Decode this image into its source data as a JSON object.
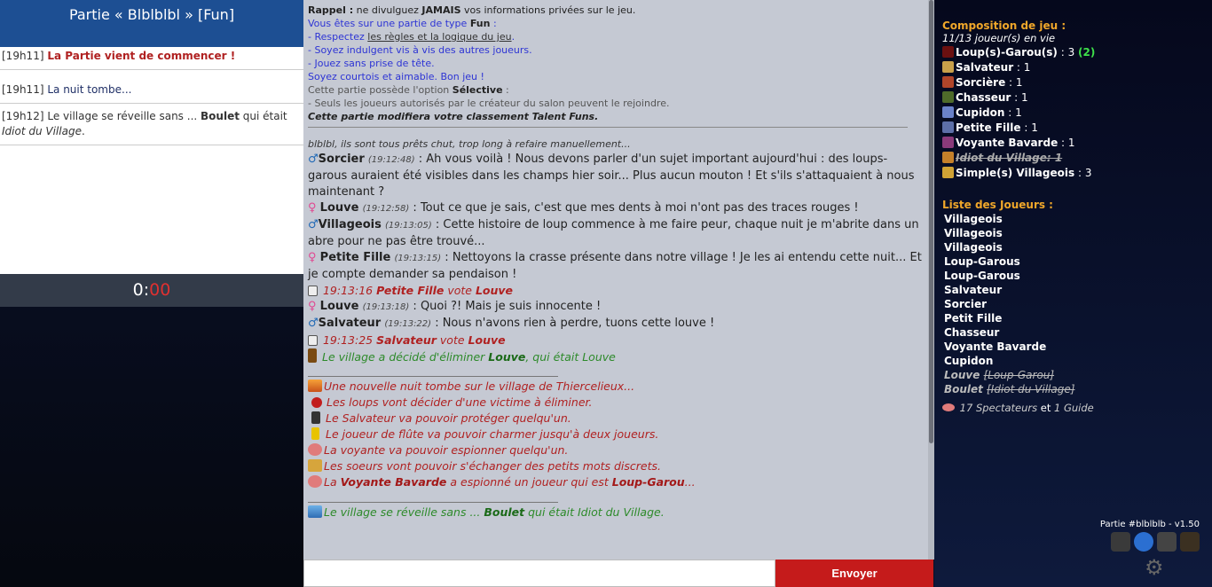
{
  "left": {
    "title": "Partie « Blblblbl » [Fun]",
    "events": [
      {
        "time": "[19h11]",
        "text": "La Partie vient de commencer !"
      },
      {
        "time": "[19h11]",
        "text": "La nuit tombe..."
      },
      {
        "time": "[19h12]",
        "pre": "Le village se réveille sans ...",
        "bold": "Boulet",
        "mid": "qui était",
        "ital": "Idiot du Village",
        "end": "."
      }
    ],
    "timer_min": "0:",
    "timer_sec": "00"
  },
  "rules": {
    "r1_label": "Rappel :",
    "r1_text": " ne divulguez ",
    "r1_bold": "JAMAIS",
    "r1_end": " vos informations privées sur le jeu.",
    "r2": "Vous êtes sur une partie de type ",
    "r2_type": "Fun",
    "r2_end": " :",
    "r3_pre": "- Respectez ",
    "r3_link": "les règles et la logique du jeu",
    "r3_end": ".",
    "r4": "- Soyez indulgent vis à vis des autres joueurs.",
    "r5": "- Jouez sans prise de tête.",
    "r6": "Soyez courtois et aimable. Bon jeu !",
    "r7": "Cette partie possède l'option ",
    "r7_bold": "Sélective",
    "r7_end": " :",
    "r8": "- Seuls les joueurs autorisés par le créateur du salon peuvent le rejoindre.",
    "r9": "Cette partie modifiera votre classement Talent Funs."
  },
  "chat": {
    "narration": "blblbl, ils sont tous prêts chut, trop long à refaire manuellement...",
    "messages": [
      {
        "gender": "♂",
        "who": "Sorcier",
        "time": "(19:12:48)",
        "text": " : Ah vous voilà ! Nous devons parler d'un sujet important aujourd'hui : des loups-garous auraient été visibles dans les champs hier soir... Plus aucun mouton ! Et s'ils s'attaquaient à nous maintenant ?"
      },
      {
        "gender": "♀",
        "who": "Louve",
        "time": "(19:12:58)",
        "text": " : Tout ce que je sais, c'est que mes dents à moi n'ont pas des traces rouges !"
      },
      {
        "gender": "♂",
        "who": "Villageois",
        "time": "(19:13:05)",
        "text": " : Cette histoire de loup commence à me faire peur, chaque nuit je m'abrite dans un abre pour ne pas être trouvé..."
      },
      {
        "gender": "♀",
        "who": "Petite Fille",
        "time": "(19:13:15)",
        "text": " : Nettoyons la crasse présente dans notre village ! Je les ai entendu cette nuit... Et je compte demander sa pendaison !"
      }
    ],
    "vote1": {
      "time": "19:13:16",
      "who": "Petite Fille",
      "verb": " vote ",
      "target": "Louve"
    },
    "messages2": [
      {
        "gender": "♀",
        "who": "Louve",
        "time": "(19:13:18)",
        "text": " : Quoi ?! Mais je suis innocente !"
      },
      {
        "gender": "♂",
        "who": "Salvateur",
        "time": "(19:13:22)",
        "text": " : Nous n'avons rien à perdre, tuons cette louve !"
      }
    ],
    "vote2": {
      "time": "19:13:25",
      "who": "Salvateur",
      "verb": " vote ",
      "target": "Louve"
    },
    "elim": {
      "pre": "Le village a décidé d'éliminer ",
      "who": "Louve",
      "end": ", qui était Louve"
    },
    "night": [
      "Une nouvelle nuit tombe sur le village de Thiercelieux...",
      "Les loups vont décider d'une victime à éliminer.",
      "Le Salvateur va pouvoir protéger quelqu'un.",
      "Le joueur de flûte va pouvoir charmer jusqu'à deux joueurs.",
      "La voyante va pouvoir espionner quelqu'un.",
      "Les soeurs vont pouvoir s'échanger des petits mots discrets."
    ],
    "spy": {
      "pre": "La ",
      "who": "Voyante Bavarde",
      "mid": " a espionné un joueur qui est ",
      "role": "Loup-Garou",
      "end": "..."
    },
    "day": {
      "pre": "Le village se réveille sans ... ",
      "who": "Boulet",
      "end": " qui était Idiot du Village."
    }
  },
  "input": {
    "placeholder": "",
    "send_label": "Envoyer"
  },
  "right": {
    "composition_title": "Composition de jeu :",
    "alive": "11/13 joueur(s) en vie",
    "roles": [
      {
        "name": "Loup(s)-Garou(s)",
        "count": " : 3 ",
        "extra": "(2)",
        "color": "#6b1010"
      },
      {
        "name": "Salvateur",
        "count": " : 1",
        "color": "#c9a04a"
      },
      {
        "name": "Sorcière",
        "count": " : 1",
        "color": "#b0452a"
      },
      {
        "name": "Chasseur",
        "count": " : 1",
        "color": "#4e6b2a"
      },
      {
        "name": "Cupidon",
        "count": " : 1",
        "color": "#6a82c9"
      },
      {
        "name": "Petite Fille",
        "count": " : 1",
        "color": "#5d6fa8"
      },
      {
        "name": "Voyante Bavarde",
        "count": " : 1",
        "color": "#8a3a7a"
      },
      {
        "name": "Idiot du Village: 1",
        "dead": true,
        "color": "#c5802a"
      },
      {
        "name": "Simple(s) Villageois",
        "count": " : 3",
        "color": "#d0a235"
      }
    ],
    "players_title": "Liste des Joueurs :",
    "players": [
      "Villageois",
      "Villageois",
      "Villageois",
      "Loup-Garous",
      "Loup-Garous",
      "Salvateur",
      "Sorcier",
      "Petit Fille",
      "Chasseur",
      "Voyante Bavarde",
      "Cupidon"
    ],
    "dead_players": [
      {
        "name": "Louve",
        "role": "[Loup-Garou]"
      },
      {
        "name": "Boulet",
        "role": "[Idiot du Village]"
      }
    ],
    "spectators": "17 Spectateurs",
    "and": " et ",
    "guides": "1 Guide",
    "version": "Partie #blblblb - v1.50"
  }
}
